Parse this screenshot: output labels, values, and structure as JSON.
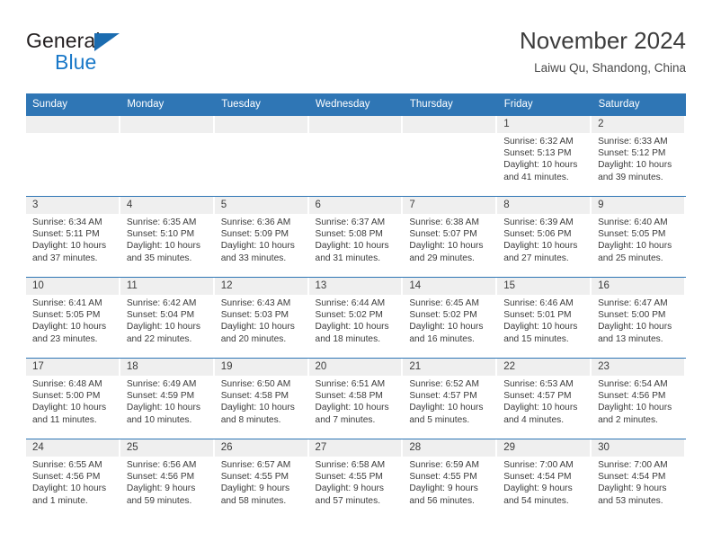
{
  "brand": {
    "line1": "General",
    "line2": "Blue",
    "triangle_color": "#1b6cb0",
    "blue_text_color": "#1978c8"
  },
  "header": {
    "title": "November 2024",
    "subtitle": "Laiwu Qu, Shandong, China",
    "accent_color": "#2f76b5"
  },
  "calendar": {
    "weekday_headers": [
      "Sunday",
      "Monday",
      "Tuesday",
      "Wednesday",
      "Thursday",
      "Friday",
      "Saturday"
    ],
    "weeks": [
      [
        {
          "day": "",
          "sunrise": "",
          "sunset": "",
          "daylight": ""
        },
        {
          "day": "",
          "sunrise": "",
          "sunset": "",
          "daylight": ""
        },
        {
          "day": "",
          "sunrise": "",
          "sunset": "",
          "daylight": ""
        },
        {
          "day": "",
          "sunrise": "",
          "sunset": "",
          "daylight": ""
        },
        {
          "day": "",
          "sunrise": "",
          "sunset": "",
          "daylight": ""
        },
        {
          "day": "1",
          "sunrise": "Sunrise: 6:32 AM",
          "sunset": "Sunset: 5:13 PM",
          "daylight": "Daylight: 10 hours and 41 minutes."
        },
        {
          "day": "2",
          "sunrise": "Sunrise: 6:33 AM",
          "sunset": "Sunset: 5:12 PM",
          "daylight": "Daylight: 10 hours and 39 minutes."
        }
      ],
      [
        {
          "day": "3",
          "sunrise": "Sunrise: 6:34 AM",
          "sunset": "Sunset: 5:11 PM",
          "daylight": "Daylight: 10 hours and 37 minutes."
        },
        {
          "day": "4",
          "sunrise": "Sunrise: 6:35 AM",
          "sunset": "Sunset: 5:10 PM",
          "daylight": "Daylight: 10 hours and 35 minutes."
        },
        {
          "day": "5",
          "sunrise": "Sunrise: 6:36 AM",
          "sunset": "Sunset: 5:09 PM",
          "daylight": "Daylight: 10 hours and 33 minutes."
        },
        {
          "day": "6",
          "sunrise": "Sunrise: 6:37 AM",
          "sunset": "Sunset: 5:08 PM",
          "daylight": "Daylight: 10 hours and 31 minutes."
        },
        {
          "day": "7",
          "sunrise": "Sunrise: 6:38 AM",
          "sunset": "Sunset: 5:07 PM",
          "daylight": "Daylight: 10 hours and 29 minutes."
        },
        {
          "day": "8",
          "sunrise": "Sunrise: 6:39 AM",
          "sunset": "Sunset: 5:06 PM",
          "daylight": "Daylight: 10 hours and 27 minutes."
        },
        {
          "day": "9",
          "sunrise": "Sunrise: 6:40 AM",
          "sunset": "Sunset: 5:05 PM",
          "daylight": "Daylight: 10 hours and 25 minutes."
        }
      ],
      [
        {
          "day": "10",
          "sunrise": "Sunrise: 6:41 AM",
          "sunset": "Sunset: 5:05 PM",
          "daylight": "Daylight: 10 hours and 23 minutes."
        },
        {
          "day": "11",
          "sunrise": "Sunrise: 6:42 AM",
          "sunset": "Sunset: 5:04 PM",
          "daylight": "Daylight: 10 hours and 22 minutes."
        },
        {
          "day": "12",
          "sunrise": "Sunrise: 6:43 AM",
          "sunset": "Sunset: 5:03 PM",
          "daylight": "Daylight: 10 hours and 20 minutes."
        },
        {
          "day": "13",
          "sunrise": "Sunrise: 6:44 AM",
          "sunset": "Sunset: 5:02 PM",
          "daylight": "Daylight: 10 hours and 18 minutes."
        },
        {
          "day": "14",
          "sunrise": "Sunrise: 6:45 AM",
          "sunset": "Sunset: 5:02 PM",
          "daylight": "Daylight: 10 hours and 16 minutes."
        },
        {
          "day": "15",
          "sunrise": "Sunrise: 6:46 AM",
          "sunset": "Sunset: 5:01 PM",
          "daylight": "Daylight: 10 hours and 15 minutes."
        },
        {
          "day": "16",
          "sunrise": "Sunrise: 6:47 AM",
          "sunset": "Sunset: 5:00 PM",
          "daylight": "Daylight: 10 hours and 13 minutes."
        }
      ],
      [
        {
          "day": "17",
          "sunrise": "Sunrise: 6:48 AM",
          "sunset": "Sunset: 5:00 PM",
          "daylight": "Daylight: 10 hours and 11 minutes."
        },
        {
          "day": "18",
          "sunrise": "Sunrise: 6:49 AM",
          "sunset": "Sunset: 4:59 PM",
          "daylight": "Daylight: 10 hours and 10 minutes."
        },
        {
          "day": "19",
          "sunrise": "Sunrise: 6:50 AM",
          "sunset": "Sunset: 4:58 PM",
          "daylight": "Daylight: 10 hours and 8 minutes."
        },
        {
          "day": "20",
          "sunrise": "Sunrise: 6:51 AM",
          "sunset": "Sunset: 4:58 PM",
          "daylight": "Daylight: 10 hours and 7 minutes."
        },
        {
          "day": "21",
          "sunrise": "Sunrise: 6:52 AM",
          "sunset": "Sunset: 4:57 PM",
          "daylight": "Daylight: 10 hours and 5 minutes."
        },
        {
          "day": "22",
          "sunrise": "Sunrise: 6:53 AM",
          "sunset": "Sunset: 4:57 PM",
          "daylight": "Daylight: 10 hours and 4 minutes."
        },
        {
          "day": "23",
          "sunrise": "Sunrise: 6:54 AM",
          "sunset": "Sunset: 4:56 PM",
          "daylight": "Daylight: 10 hours and 2 minutes."
        }
      ],
      [
        {
          "day": "24",
          "sunrise": "Sunrise: 6:55 AM",
          "sunset": "Sunset: 4:56 PM",
          "daylight": "Daylight: 10 hours and 1 minute."
        },
        {
          "day": "25",
          "sunrise": "Sunrise: 6:56 AM",
          "sunset": "Sunset: 4:56 PM",
          "daylight": "Daylight: 9 hours and 59 minutes."
        },
        {
          "day": "26",
          "sunrise": "Sunrise: 6:57 AM",
          "sunset": "Sunset: 4:55 PM",
          "daylight": "Daylight: 9 hours and 58 minutes."
        },
        {
          "day": "27",
          "sunrise": "Sunrise: 6:58 AM",
          "sunset": "Sunset: 4:55 PM",
          "daylight": "Daylight: 9 hours and 57 minutes."
        },
        {
          "day": "28",
          "sunrise": "Sunrise: 6:59 AM",
          "sunset": "Sunset: 4:55 PM",
          "daylight": "Daylight: 9 hours and 56 minutes."
        },
        {
          "day": "29",
          "sunrise": "Sunrise: 7:00 AM",
          "sunset": "Sunset: 4:54 PM",
          "daylight": "Daylight: 9 hours and 54 minutes."
        },
        {
          "day": "30",
          "sunrise": "Sunrise: 7:00 AM",
          "sunset": "Sunset: 4:54 PM",
          "daylight": "Daylight: 9 hours and 53 minutes."
        }
      ]
    ]
  }
}
